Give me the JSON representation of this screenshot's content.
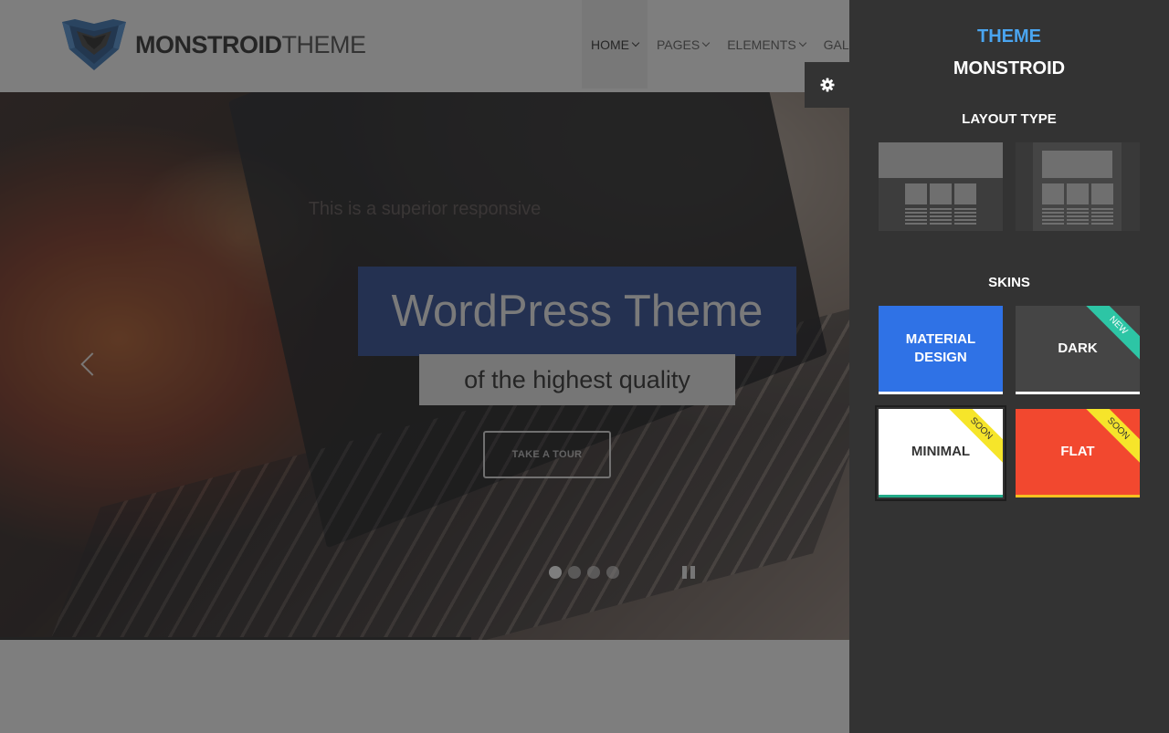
{
  "header": {
    "brand_bold": "MONSTROID",
    "brand_light": "THEME",
    "nav": [
      {
        "label": "HOME",
        "active": true
      },
      {
        "label": "PAGES",
        "active": false
      },
      {
        "label": "ELEMENTS",
        "active": false
      },
      {
        "label": "GAL",
        "active": false
      }
    ]
  },
  "hero": {
    "subtitle": "This is a superior responsive",
    "title": "WordPress Theme",
    "tagline": "of the highest quality",
    "button_label": "TAKE A TOUR",
    "slides_count": 4,
    "active_slide": 1
  },
  "panel": {
    "title_accent": "THEME",
    "title_main": "MONSTROID",
    "layout_section": "LAYOUT TYPE",
    "layout_types": [
      "full-width",
      "boxed"
    ],
    "skins_section": "SKINS",
    "skins": [
      {
        "label": "MATERIAL DESIGN",
        "line1": "MATERIAL",
        "line2": "DESIGN",
        "ribbon": ""
      },
      {
        "label": "DARK",
        "ribbon": "NEW"
      },
      {
        "label": "MINIMAL",
        "ribbon": "SOON"
      },
      {
        "label": "FLAT",
        "ribbon": "SOON"
      }
    ]
  },
  "colors": {
    "accent": "#4aa5f0",
    "panel_bg": "#333333",
    "title_box": "#1f3f8f",
    "material": "#2f72e6",
    "flat": "#f2482f",
    "ribbon_new": "#2dc5a5",
    "ribbon_soon": "#f6e52a"
  },
  "icons": [
    "logo-shield-icon",
    "chevron-down-icon",
    "chevron-left-icon",
    "pause-icon",
    "gear-icon"
  ]
}
